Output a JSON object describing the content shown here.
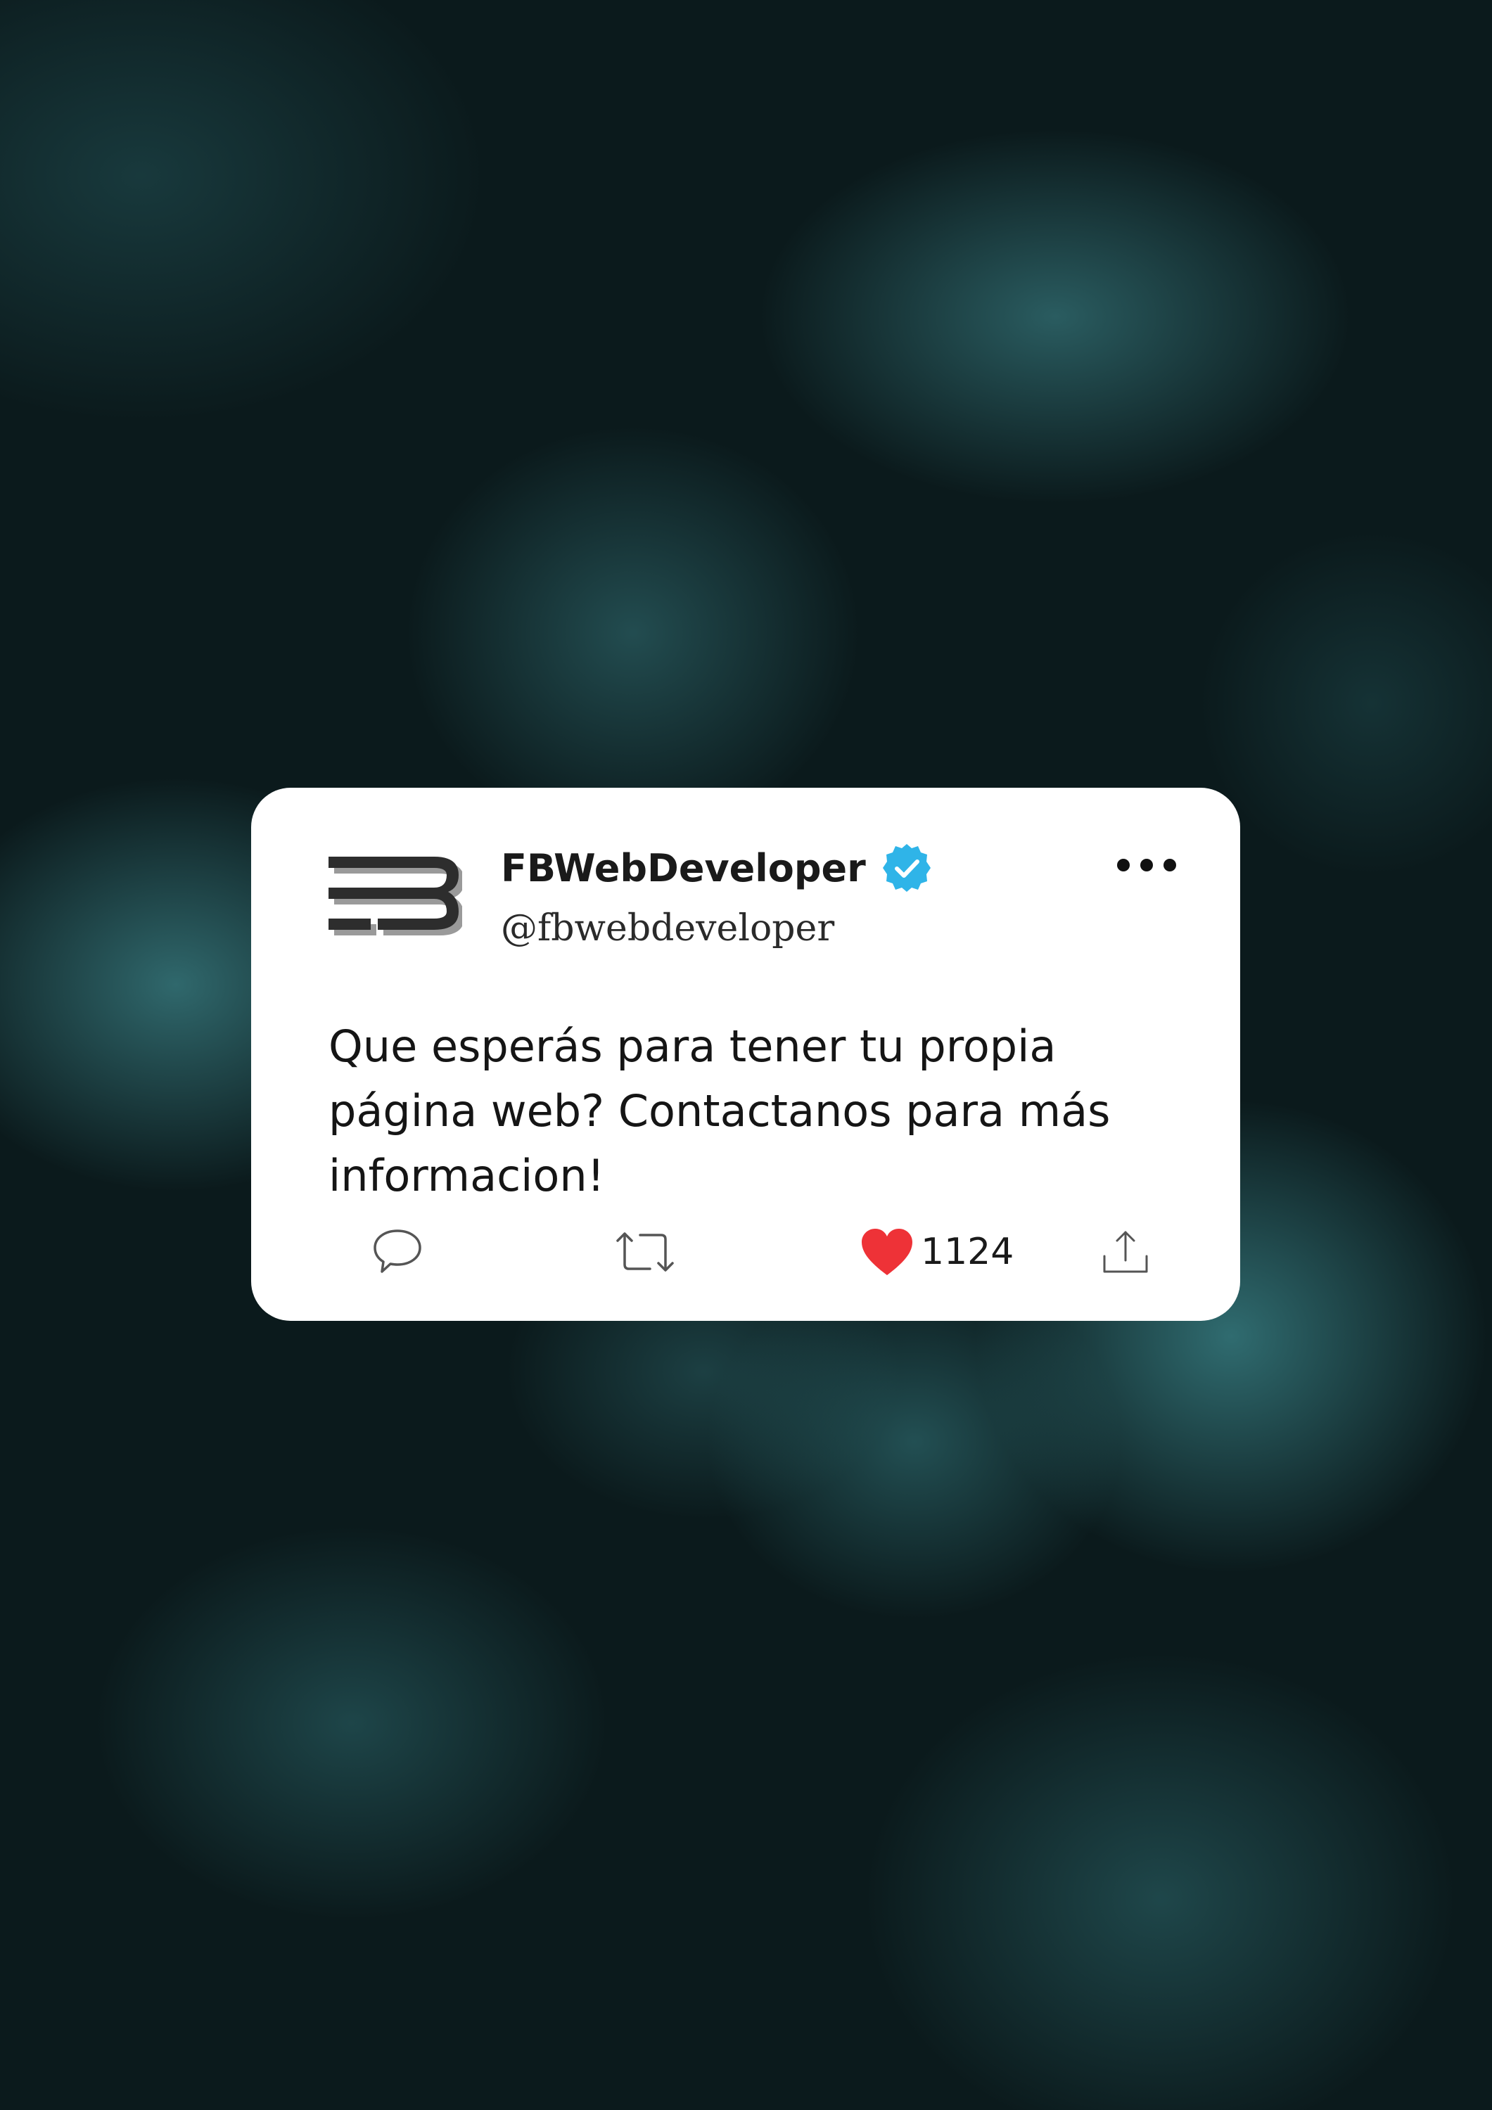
{
  "tweet": {
    "display_name": "FBWebDeveloper",
    "handle": "@fbwebdeveloper",
    "verified_icon": "verified-badge-icon",
    "more_icon": "more-dots-icon",
    "avatar_icon": "fb-logo-icon",
    "text": "Que esperás para tener tu propia página web? Contactanos para más informacion!",
    "like_count": "1124",
    "actions": {
      "reply_icon": "comment-bubble-icon",
      "retweet_icon": "retweet-icon",
      "like_icon": "heart-icon",
      "share_icon": "share-upload-icon"
    }
  },
  "colors": {
    "background": "#0b1a1c",
    "accent_teal": "#3c8287",
    "card": "#ffffff",
    "verified_blue": "#2fb4e8",
    "heart_red": "#ee3237",
    "icon_gray": "#555555"
  }
}
